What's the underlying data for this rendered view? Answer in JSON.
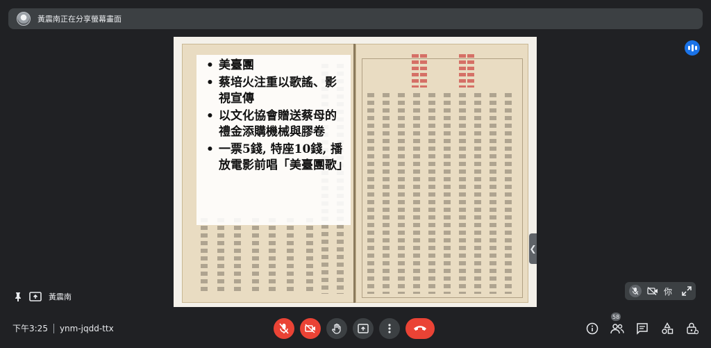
{
  "banner": {
    "text": "黃震南正在分享螢幕畫面"
  },
  "slide": {
    "bullets": [
      "美臺團",
      "蔡培火注重以歌謠、影視宣傳",
      "以文化協會贈送蔡母的禮金添購機械與膠卷",
      "一票5錢, 特座10錢, 播放電影前唱「美臺團歌」"
    ]
  },
  "presenter": {
    "name": "黃震南"
  },
  "self_tile": {
    "name": "你"
  },
  "meeting": {
    "time": "下午3:25",
    "code": "ynm-jqdd-ttx"
  },
  "participants": {
    "count": "58"
  },
  "colors": {
    "background": "#202124",
    "surface": "#3c4043",
    "danger": "#ea4335",
    "accent": "#1a73e8"
  }
}
